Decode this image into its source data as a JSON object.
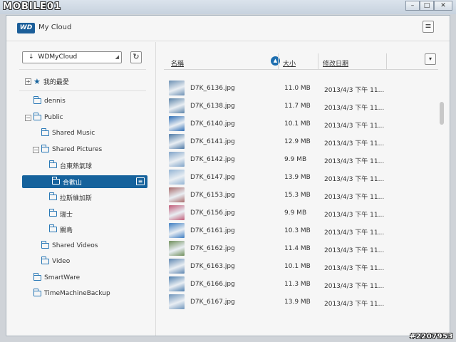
{
  "window": {
    "watermark_logo": "MOBILE01",
    "minimize_glyph": "–",
    "maximize_glyph": "□",
    "close_glyph": "✕"
  },
  "header": {
    "logo_text": "WD",
    "app_title": "My Cloud",
    "menu_icon": "hamburger-icon"
  },
  "left_pane": {
    "device_name": "WDMyCloud",
    "device_icon_glyph": "↓",
    "refresh_icon": "refresh-icon",
    "favorites_label": "我的最愛",
    "tree": [
      {
        "label": "dennis",
        "indent": 0,
        "expander": ""
      },
      {
        "label": "Public",
        "indent": 0,
        "expander": "−"
      },
      {
        "label": "Shared Music",
        "indent": 1,
        "expander": ""
      },
      {
        "label": "Shared Pictures",
        "indent": 1,
        "expander": "−"
      },
      {
        "label": "台東熱氣球",
        "indent": 2,
        "expander": ""
      },
      {
        "label": "合歡山",
        "indent": 2,
        "expander": "",
        "selected": true
      },
      {
        "label": "拉斯維加斯",
        "indent": 2,
        "expander": ""
      },
      {
        "label": "瑞士",
        "indent": 2,
        "expander": ""
      },
      {
        "label": "關島",
        "indent": 2,
        "expander": ""
      },
      {
        "label": "Shared Videos",
        "indent": 1,
        "expander": ""
      },
      {
        "label": "Video",
        "indent": 1,
        "expander": ""
      },
      {
        "label": "SmartWare",
        "indent": 0,
        "expander": ""
      },
      {
        "label": "TimeMachineBackup",
        "indent": 0,
        "expander": ""
      }
    ]
  },
  "file_list": {
    "columns": {
      "name": "名稱",
      "size": "大小",
      "modified": "修改日期"
    },
    "sort_glyph": "▲",
    "view_glyph": "▾",
    "rows": [
      {
        "name": "D7K_6136.jpg",
        "size": "11.0 MB",
        "date": "2013/4/3 下午 11...",
        "color": "#6b8fb3"
      },
      {
        "name": "D7K_6138.jpg",
        "size": "11.7 MB",
        "date": "2013/4/3 下午 11...",
        "color": "#5b83a8"
      },
      {
        "name": "D7K_6140.jpg",
        "size": "10.1 MB",
        "date": "2013/4/3 下午 11...",
        "color": "#2f6eb5"
      },
      {
        "name": "D7K_6141.jpg",
        "size": "12.9 MB",
        "date": "2013/4/3 下午 11...",
        "color": "#4d79a6"
      },
      {
        "name": "D7K_6142.jpg",
        "size": "9.9 MB",
        "date": "2013/4/3 下午 11...",
        "color": "#7fa3c8"
      },
      {
        "name": "D7K_6147.jpg",
        "size": "13.9 MB",
        "date": "2013/4/3 下午 11...",
        "color": "#93b4d4"
      },
      {
        "name": "D7K_6153.jpg",
        "size": "15.3 MB",
        "date": "2013/4/3 下午 11...",
        "color": "#a86a6a"
      },
      {
        "name": "D7K_6156.jpg",
        "size": "9.9 MB",
        "date": "2013/4/3 下午 11...",
        "color": "#c25b78"
      },
      {
        "name": "D7K_6161.jpg",
        "size": "10.3 MB",
        "date": "2013/4/3 下午 11...",
        "color": "#3d7dc2"
      },
      {
        "name": "D7K_6162.jpg",
        "size": "11.4 MB",
        "date": "2013/4/3 下午 11...",
        "color": "#6e8e5a"
      },
      {
        "name": "D7K_6163.jpg",
        "size": "10.1 MB",
        "date": "2013/4/3 下午 11...",
        "color": "#5d85b0"
      },
      {
        "name": "D7K_6166.jpg",
        "size": "11.3 MB",
        "date": "2013/4/3 下午 11...",
        "color": "#4f7fae"
      },
      {
        "name": "D7K_6167.jpg",
        "size": "13.9 MB",
        "date": "2013/4/3 下午 11...",
        "color": "#6f95bb"
      }
    ]
  },
  "footer_watermark": "#2207953"
}
